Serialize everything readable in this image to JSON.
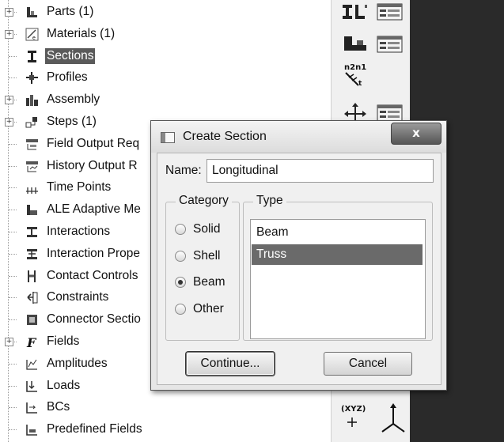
{
  "tree": {
    "items": [
      {
        "label": "Parts (1)",
        "icon": "parts-icon",
        "expander": "+",
        "selected": false
      },
      {
        "label": "Materials (1)",
        "icon": "materials-icon",
        "expander": "+",
        "selected": false
      },
      {
        "label": "Sections",
        "icon": "sections-icon",
        "expander": "",
        "selected": true
      },
      {
        "label": "Profiles",
        "icon": "profiles-icon",
        "expander": "",
        "selected": false
      },
      {
        "label": "Assembly",
        "icon": "assembly-icon",
        "expander": "+",
        "selected": false
      },
      {
        "label": "Steps (1)",
        "icon": "steps-icon",
        "expander": "+",
        "selected": false
      },
      {
        "label": "Field Output Req",
        "icon": "field-output-icon",
        "expander": "",
        "selected": false
      },
      {
        "label": "History Output R",
        "icon": "history-output-icon",
        "expander": "",
        "selected": false
      },
      {
        "label": "Time Points",
        "icon": "time-points-icon",
        "expander": "",
        "selected": false
      },
      {
        "label": "ALE Adaptive Me",
        "icon": "ale-adaptive-icon",
        "expander": "",
        "selected": false
      },
      {
        "label": "Interactions",
        "icon": "interactions-icon",
        "expander": "",
        "selected": false
      },
      {
        "label": "Interaction Prope",
        "icon": "interaction-properties-icon",
        "expander": "",
        "selected": false
      },
      {
        "label": "Contact Controls",
        "icon": "contact-controls-icon",
        "expander": "",
        "selected": false
      },
      {
        "label": "Constraints",
        "icon": "constraints-icon",
        "expander": "",
        "selected": false
      },
      {
        "label": "Connector Sectio",
        "icon": "connector-sections-icon",
        "expander": "",
        "selected": false
      },
      {
        "label": "Fields",
        "icon": "fields-icon",
        "expander": "+",
        "selected": false
      },
      {
        "label": "Amplitudes",
        "icon": "amplitudes-icon",
        "expander": "",
        "selected": false
      },
      {
        "label": "Loads",
        "icon": "loads-icon",
        "expander": "",
        "selected": false
      },
      {
        "label": "BCs",
        "icon": "bcs-icon",
        "expander": "",
        "selected": false
      },
      {
        "label": "Predefined Fields",
        "icon": "predefined-fields-icon",
        "expander": "",
        "selected": false
      }
    ]
  },
  "toolbox": {
    "tools": [
      {
        "icon": "section-assign-icon",
        "text": "ƎL"
      },
      {
        "icon": "section-manager-icon",
        "text": ""
      },
      {
        "icon": "beam-orientation-icon",
        "text": ""
      },
      {
        "icon": "beam-orientation-manager-icon",
        "text": ""
      },
      {
        "icon": "normal-tangent-icon",
        "text": "n2n1"
      },
      {
        "icon": "move-assign-icon",
        "text": ""
      },
      {
        "icon": "move-manager-icon",
        "text": ""
      },
      {
        "icon": "csys-icon",
        "text": "(XYZ)"
      },
      {
        "icon": "datum-axes-icon",
        "text": ""
      }
    ]
  },
  "dialog": {
    "title": "Create Section",
    "close_label": "x",
    "name_label": "Name:",
    "name_value": "Longitudinal",
    "category_title": "Category",
    "categories": [
      {
        "label": "Solid",
        "checked": false
      },
      {
        "label": "Shell",
        "checked": false
      },
      {
        "label": "Beam",
        "checked": true
      },
      {
        "label": "Other",
        "checked": false
      }
    ],
    "type_title": "Type",
    "types": [
      {
        "label": "Beam",
        "selected": false
      },
      {
        "label": "Truss",
        "selected": true
      }
    ],
    "continue_label": "Continue...",
    "cancel_label": "Cancel"
  },
  "colors": {
    "selection": "#5a5a5a",
    "list_selection": "#6a6a6a",
    "viewport": "#2a2a2a"
  }
}
